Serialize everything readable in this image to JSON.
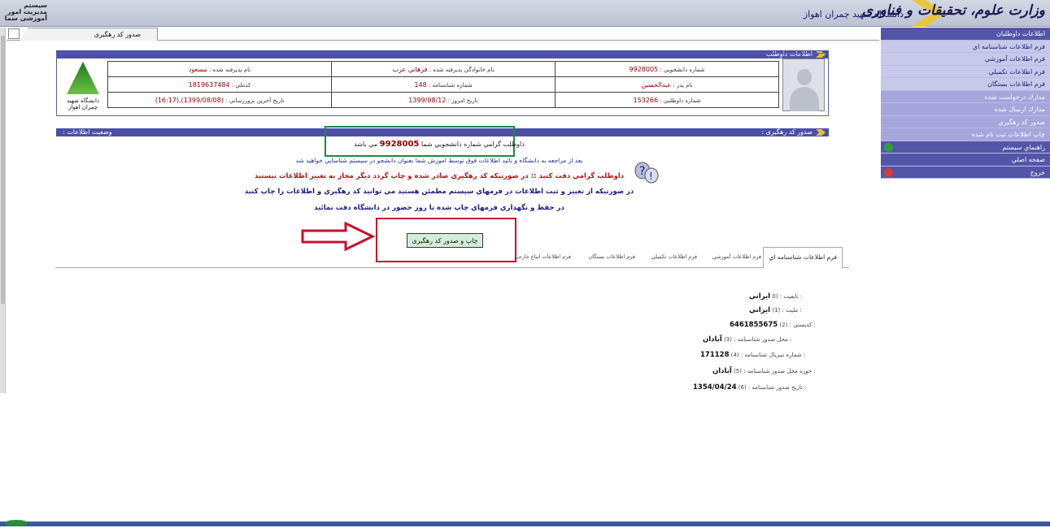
{
  "header": {
    "left_title": "سیستم مدیریت امور آموزشی سما",
    "university": "دانشگاه شهید چمران اهواز",
    "ministry": "وزارت علوم، تحقیقات و فناوری"
  },
  "tabbar": {
    "active_tab": "صدور کد رهگیری"
  },
  "sidebar": {
    "items": [
      {
        "label": "اطلاعات داوطلبان",
        "kind": "hd"
      },
      {
        "label": "فرم اطلاعات شناسنامه اي",
        "kind": "sub"
      },
      {
        "label": "فرم اطلاعات آموزشي",
        "kind": "sub"
      },
      {
        "label": "فرم اطلاعات تكميلي",
        "kind": "sub"
      },
      {
        "label": "فرم اطلاعات بستگان",
        "kind": "sub"
      },
      {
        "label": "مدارك درخواست شده",
        "kind": "mi"
      },
      {
        "label": "مدارك ارسال شده",
        "kind": "mi"
      },
      {
        "label": "صدور كد رهگيري",
        "kind": "mi"
      },
      {
        "label": "چاپ اطلاعات ثبت نام شده",
        "kind": "mi"
      },
      {
        "label": "راهنماي سيستم",
        "kind": "hd",
        "icon": "help-icon",
        "color": "#2f9e3a"
      },
      {
        "label": "صفحه اصلي",
        "kind": "hd",
        "icon": "home-icon",
        "color": "#5356a8"
      },
      {
        "label": "خروج",
        "kind": "hd",
        "icon": "exit-icon",
        "color": "#d33b3b"
      }
    ]
  },
  "info_panel": {
    "title": "اطلاعات داوطلب",
    "rows": [
      [
        {
          "label": "شماره دانشجويي :",
          "value": "9928005"
        },
        {
          "label": "نام خانوادگي پذيرفته شده :",
          "value": "فرهاني عرب"
        },
        {
          "label": "نام پذيرفته شده :",
          "value": "مسعود"
        }
      ],
      [
        {
          "label": "نام پدر :",
          "value": "عبدالحسين"
        },
        {
          "label": "شماره شناسنامه :",
          "value": "148"
        },
        {
          "label": "كدملي :",
          "value": "1819637484"
        }
      ],
      [
        {
          "label": "شماره داوطلبي :",
          "value": "153266"
        },
        {
          "label": "تاريخ امروز :",
          "value": "1399/08/12"
        },
        {
          "label": "تاريخ آخرين بروزرساني :",
          "value": "(1399/08/08),(16:17)"
        }
      ]
    ],
    "logo_text": "دانشگاه شهید چمران اهواز"
  },
  "tracking_panel": {
    "title": "صدور کد رهگیری :",
    "status_label": "وضعيت اطلاعات :"
  },
  "messages": {
    "student_no_prefix": "داوطلب گرامي شماره دانشجويي شما",
    "student_no": "9928005",
    "student_no_suffix": "مي باشد",
    "info_line": "بعد از مراجعه به دانشگاه و تائيد اطلاعات فوق توسط اموزش شما بعنوان دانشجو در سيستم شناسايي خواهيد شد",
    "warning_line": "داوطلب گرامي دقت كنيد :: در صورتيكه كد رهگيري صادر شده و چاپ گردد ديگر مجاز به تغيير اطلاعات نيستيد",
    "line_4": "در صورتيكه از تغيير و ثبت اطلاعات در فرمهاي سيستم مطمئن هستيد مي توانيد كد رهگيري و اطلاعات را چاپ كنيد",
    "line_5": "در حفظ و نگهداري فرمهاي چاپ شده تا روز حضور در دانشگاه دقت نمائيد"
  },
  "print_button": {
    "label": "چاپ و صدور کد رهگیری"
  },
  "form_tabs": [
    {
      "label": "فرم اطلاعات شناسنامه اي",
      "active": true
    },
    {
      "label": "فرم اطلاعات آموزشي",
      "active": false
    },
    {
      "label": "فرم اطلاعات تكميلي",
      "active": false
    },
    {
      "label": "فرم اطلاعات بستگان",
      "active": false
    },
    {
      "label": "فرم اطلاعات اتباع خارجي",
      "active": false
    }
  ],
  "fields": [
    {
      "label": "0) : تابعيت :",
      "value": "ايراني"
    },
    {
      "label": "(1) : مليت :",
      "value": "ايراني"
    },
    {
      "label": "(2) : كدپستي :",
      "value": "6461855675"
    },
    {
      "label": "(3) : محل صدور شناسنامه :",
      "value": "آبادان"
    },
    {
      "label": "(4) : شماره سريال شناسنامه :",
      "value": "171128"
    },
    {
      "label": "(5) : حوزه محل صدور شناسنامه :",
      "value": "آبادان"
    },
    {
      "label": "(6) : تاريخ صدور شناسنامه :",
      "value": "1354/04/24"
    }
  ]
}
